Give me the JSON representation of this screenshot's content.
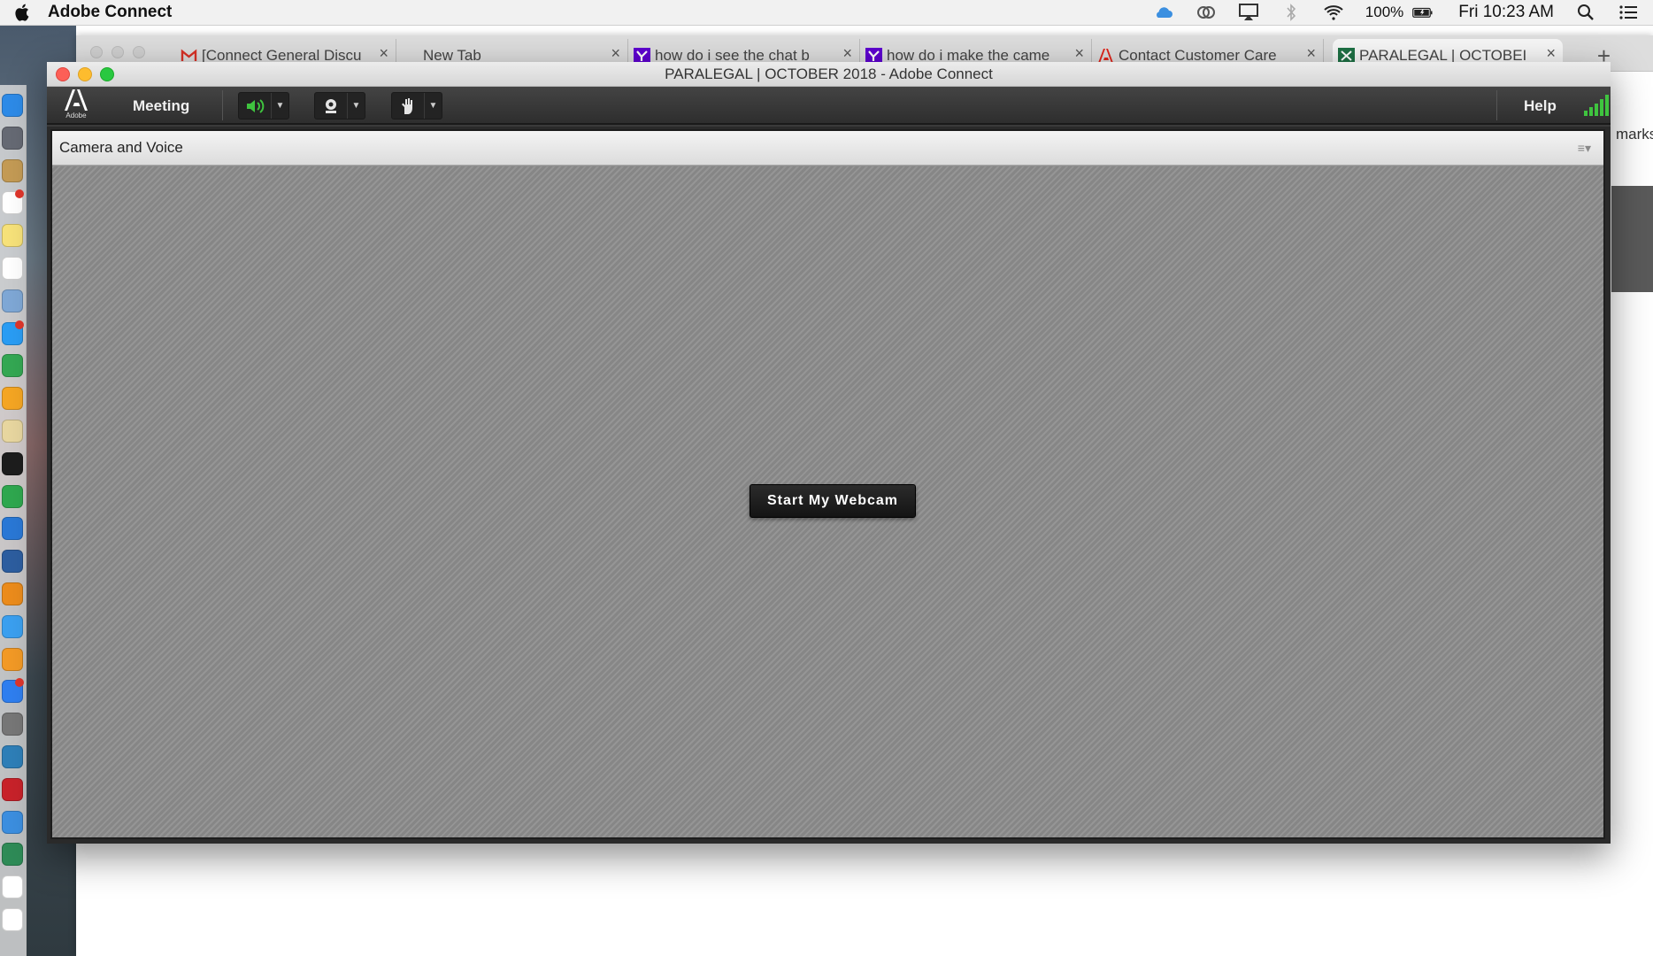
{
  "menubar": {
    "app_name": "Adobe Connect",
    "battery": "100%",
    "clock": "Fri 10:23 AM",
    "icons": [
      "apple-icon",
      "cloud-icon",
      "creative-cloud-icon",
      "airplay-icon",
      "bluetooth-icon",
      "wifi-icon",
      "battery-icon",
      "spotlight-search-icon",
      "notification-center-icon"
    ]
  },
  "dock": {
    "items": [
      "finder",
      "launchpad",
      "notes",
      "calendar",
      "stickies",
      "reminders",
      "preview",
      "messages",
      "chrome",
      "photos",
      "textedit",
      "skype",
      "numbers",
      "keynote",
      "ftp",
      "vlc",
      "itunes",
      "ibooks",
      "app-store",
      "system-preferences",
      "connect",
      "acrobat",
      "safari",
      "adobe-connect",
      "pdf-doc",
      "pdf-doc-2"
    ],
    "colors": [
      "#2d8be8",
      "#666a74",
      "#c49b55",
      "#ffffff",
      "#f7e27a",
      "#ffffff",
      "#7fa8d6",
      "#2a9df4",
      "#34a853",
      "#f5a623",
      "#e8d7a0",
      "#1d1d1d",
      "#2fa84f",
      "#2a78d6",
      "#2d5ea0",
      "#ec8c1c",
      "#3ba0f0",
      "#f39a26",
      "#2f7ff0",
      "#777777",
      "#2e7fb8",
      "#c8222a",
      "#3c8fe0",
      "#2e8b57",
      "#ffffff",
      "#ffffff"
    ]
  },
  "browser": {
    "tabs": [
      {
        "title": "[Connect General Discu",
        "favicon": "gmail-icon",
        "favicon_color": "#d93025"
      },
      {
        "title": "New Tab",
        "favicon": "",
        "favicon_color": ""
      },
      {
        "title": "how do i see the chat b",
        "favicon": "yahoo-icon",
        "favicon_color": "#5f01d1"
      },
      {
        "title": "how do i make the came",
        "favicon": "yahoo-icon",
        "favicon_color": "#5f01d1"
      },
      {
        "title": "Contact Customer Care",
        "favicon": "adobe-icon",
        "favicon_color": "#e1251b"
      },
      {
        "title": "PARALEGAL | OCTOBEI",
        "favicon": "spreadsheet-icon",
        "favicon_color": "#1e7145"
      }
    ],
    "new_tab_label": "+",
    "close_label": "×",
    "bookmarks_snippet": "marks",
    "menu_label": "⋮"
  },
  "window": {
    "title": "PARALEGAL | OCTOBER 2018 - Adobe Connect"
  },
  "toolbar": {
    "logo_text": "Adobe",
    "meeting_label": "Meeting",
    "help_label": "Help",
    "caret": "▼",
    "accent": "#3fc43f"
  },
  "pod": {
    "title": "Camera and Voice",
    "menu_glyph": "≡▾",
    "start_button": "Start My Webcam"
  }
}
